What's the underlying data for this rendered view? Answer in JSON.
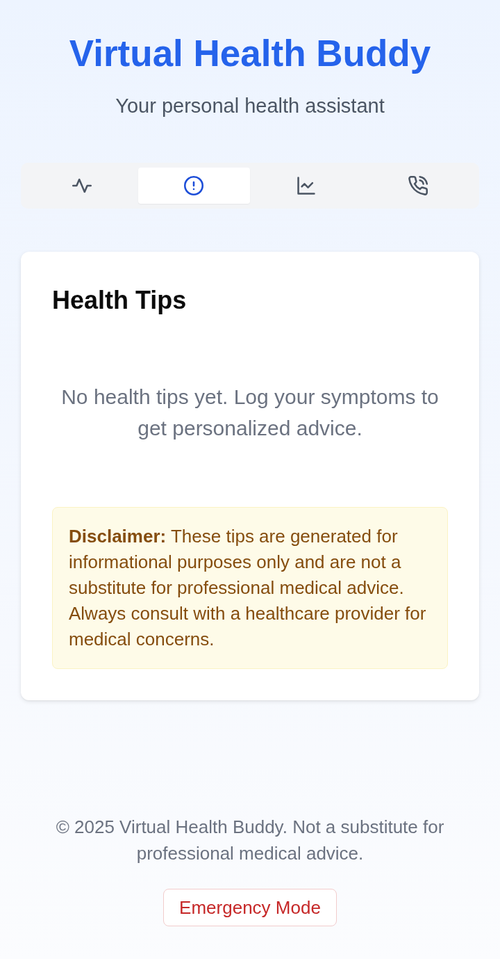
{
  "header": {
    "title": "Virtual Health Buddy",
    "subtitle": "Your personal health assistant"
  },
  "tabs": [
    {
      "selected": false
    },
    {
      "selected": true
    },
    {
      "selected": false
    },
    {
      "selected": false
    }
  ],
  "card": {
    "title": "Health Tips",
    "empty_message": "No health tips yet. Log your symptoms to get personalized advice.",
    "disclaimer": "**Disclaimer:** These tips are generated for informational purposes only and are not a substitute for professional medical advice. Always consult with a healthcare provider for medical concerns."
  },
  "footer": {
    "text": "© 2025 Virtual Health Buddy. Not a substitute for professional medical advice.",
    "emergency_button": "Emergency Mode"
  }
}
